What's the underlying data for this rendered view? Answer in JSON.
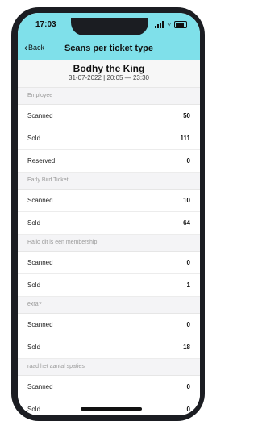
{
  "status_bar": {
    "time": "17:03"
  },
  "nav": {
    "back_label": "Back",
    "title": "Scans per ticket type"
  },
  "event": {
    "name": "Bodhy the King",
    "date": "31-07-2022 | 20:05 — 23:30"
  },
  "sections": [
    {
      "title": "Employee",
      "rows": [
        {
          "label": "Scanned",
          "value": "50"
        },
        {
          "label": "Sold",
          "value": "111"
        },
        {
          "label": "Reserved",
          "value": "0"
        }
      ]
    },
    {
      "title": "Early Bird Ticket",
      "rows": [
        {
          "label": "Scanned",
          "value": "10"
        },
        {
          "label": "Sold",
          "value": "64"
        }
      ]
    },
    {
      "title": "Hallo dit is een membership",
      "rows": [
        {
          "label": "Scanned",
          "value": "0"
        },
        {
          "label": "Sold",
          "value": "1"
        }
      ]
    },
    {
      "title": "exra?",
      "rows": [
        {
          "label": "Scanned",
          "value": "0"
        },
        {
          "label": "Sold",
          "value": "18"
        }
      ]
    },
    {
      "title": "raad het aantal spaties",
      "rows": [
        {
          "label": "Scanned",
          "value": "0"
        },
        {
          "label": "Sold",
          "value": "0"
        }
      ]
    }
  ],
  "colors": {
    "header_accent": "#7fe0ea",
    "section_bg": "#f4f4f6",
    "frame": "#1b1d22"
  },
  "icons": [
    "chevron-left-icon",
    "signal-icon",
    "wifi-icon",
    "battery-icon"
  ]
}
